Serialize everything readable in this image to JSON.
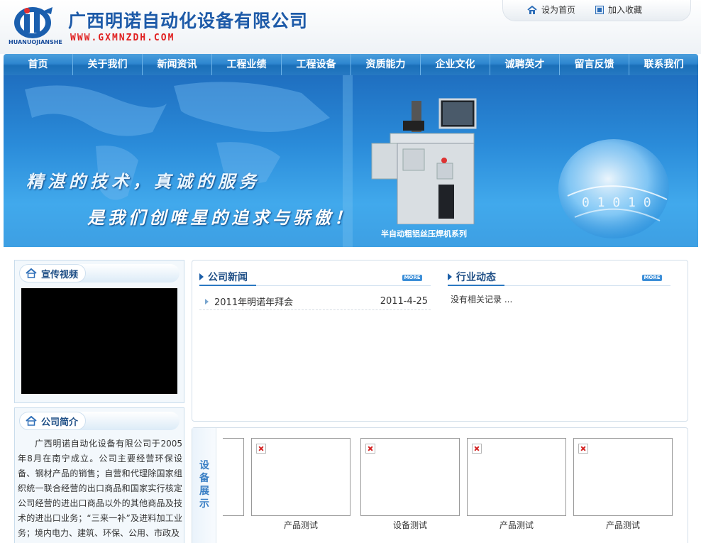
{
  "header": {
    "logo_sub": "HUANUOJIANSHE",
    "company_name": "广西明诺自动化设备有限公司",
    "company_url": "WWW.GXMNZDH.COM",
    "set_home": "设为首页",
    "add_favorite": "加入收藏"
  },
  "nav": [
    "首页",
    "关于我们",
    "新闻资讯",
    "工程业绩",
    "工程设备",
    "资质能力",
    "企业文化",
    "诚聘英才",
    "留言反馈",
    "联系我们"
  ],
  "banner": {
    "slogan_line1": "精湛的技术，真诚的服务",
    "slogan_line2": "是我们创唯星的追求与骄傲！",
    "caption": "半自动粗铝丝压焊机系列"
  },
  "video_panel": {
    "title": "宣传视频"
  },
  "intro_panel": {
    "title": "公司简介",
    "text": "广西明诺自动化设备有限公司于2005年8月在南宁成立。公司主要经营环保设备、钢材产品的销售；自营和代理除国家组织统一联合经营的出口商品和国家实行核定公司经营的进出口商品以外的其他商品及技术的进出口业务；“三来一补”及进料加工业务；境内电力、建筑、环保、公用、市政及"
  },
  "company_news": {
    "title": "公司新闻",
    "more": "MORE",
    "items": [
      {
        "title": "2011年明诺年拜会",
        "date": "2011-4-25"
      }
    ]
  },
  "industry_news": {
    "title": "行业动态",
    "more": "MORE",
    "empty_text": "没有相关记录 ..."
  },
  "equipment": {
    "label": "设备展示",
    "items": [
      {
        "caption": "产品测试"
      },
      {
        "caption": "设备测试"
      },
      {
        "caption": "产品测试"
      },
      {
        "caption": "产品测试"
      }
    ]
  },
  "colors": {
    "brand_blue": "#1d5aa8",
    "url_red": "#e02020",
    "nav_blue": "#2679c2"
  }
}
